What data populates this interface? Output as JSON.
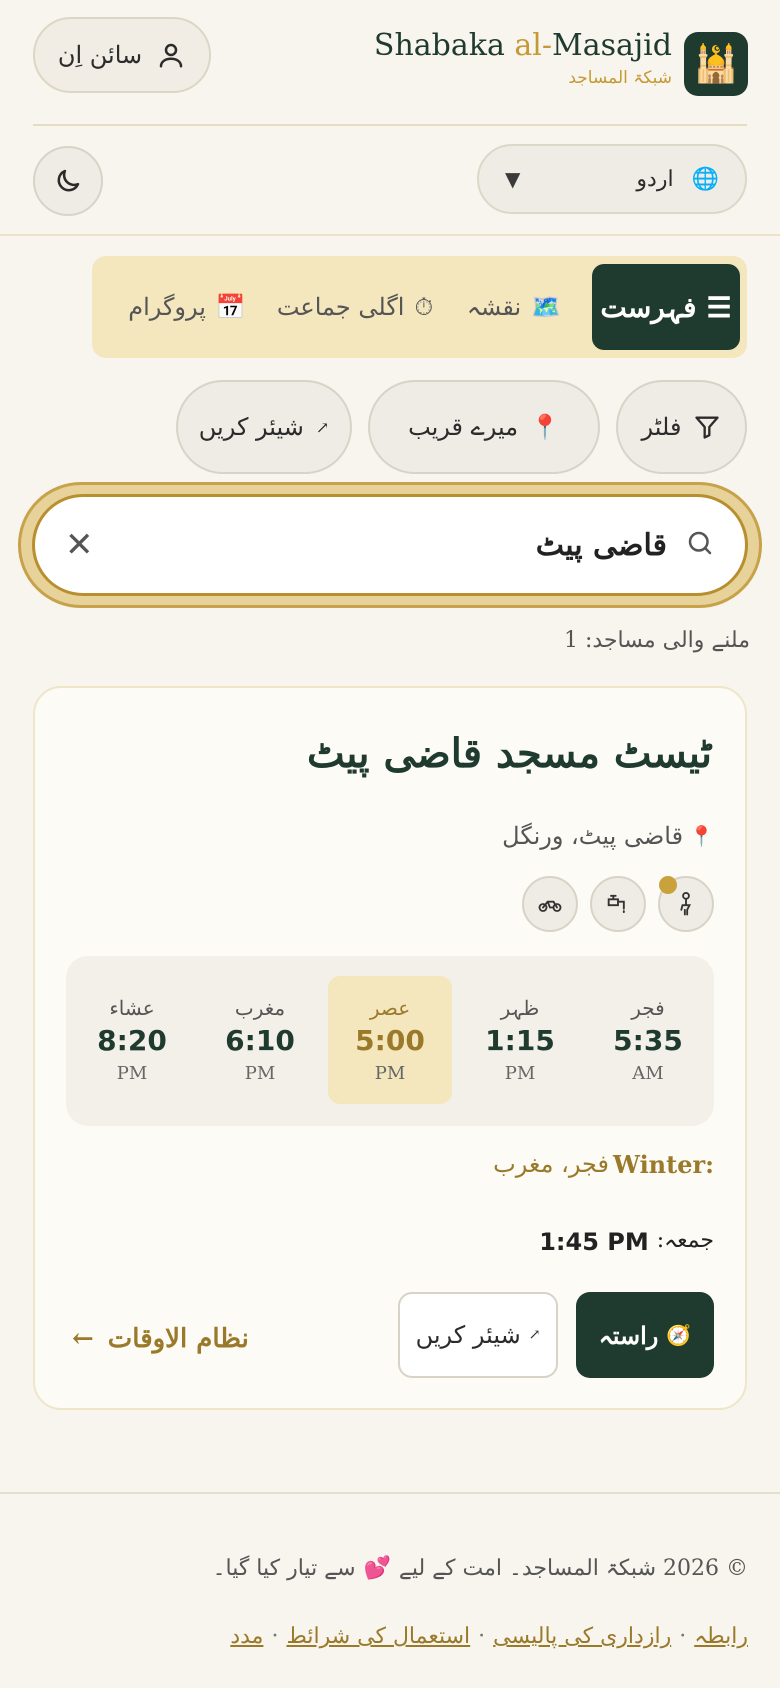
{
  "header": {
    "signin_label": "سائن اِن",
    "brand_title_pre": "Shabaka ",
    "brand_title_al": "al-",
    "brand_title_post": "Masajid",
    "brand_subtitle": "شبکۃ المساجد",
    "logo_emoji": "🕌"
  },
  "language": {
    "selected": "اردو",
    "globe": "🌐",
    "arrow": "▼"
  },
  "tabs": [
    {
      "label": "فہرست",
      "icon": "☰",
      "active": true
    },
    {
      "label": "نقشہ",
      "icon": "🗺️",
      "active": false
    },
    {
      "label": "اگلی جماعت",
      "icon": "⏱",
      "active": false
    },
    {
      "label": "پروگرام",
      "icon": "📅",
      "active": false
    }
  ],
  "actions": {
    "filter_label": "فلٹر",
    "nearby_label": "میرے قریب",
    "nearby_icon": "📍",
    "share_label": "شیئر کریں",
    "share_icon": "↗"
  },
  "search": {
    "value": "قاضی پیٹ",
    "clear": "✕"
  },
  "results": {
    "count_text": "ملنے والی مساجد: 1"
  },
  "mosque": {
    "name": "ٹیسٹ مسجد قاضی پیٹ",
    "location_icon": "📍",
    "location": "قاضی پیٹ، ورنگل",
    "prayers": [
      {
        "name": "فجر",
        "time": "5:35",
        "ampm": "AM",
        "active": false
      },
      {
        "name": "ظہر",
        "time": "1:15",
        "ampm": "PM",
        "active": false
      },
      {
        "name": "عصر",
        "time": "5:00",
        "ampm": "PM",
        "active": true
      },
      {
        "name": "مغرب",
        "time": "6:10",
        "ampm": "PM",
        "active": false
      },
      {
        "name": "عشاء",
        "time": "8:20",
        "ampm": "PM",
        "active": false
      }
    ],
    "season_label": "Winter:",
    "season_value": "فجر، مغرب",
    "juma_label": "جمعہ:",
    "juma_time": "1:45 PM",
    "route_label": "راستہ",
    "route_icon": "🧭",
    "share_label": "شیئر کریں",
    "share_icon": "↗",
    "schedule_label": "نظام الاوقات",
    "schedule_arrow": "←"
  },
  "footer": {
    "copyright": "© 2026 شبکۃ المساجد۔ امت کے لیے",
    "heart": "💕",
    "made_text": "سے تیار کیا گیا۔",
    "links": [
      "رابطہ",
      "رازداری کی پالیسی",
      "استعمال کی شرائط",
      "مدد"
    ],
    "sep": "·"
  },
  "colors": {
    "primary": "#1f3a2e",
    "accent": "#c39a35",
    "background": "#f8f5ee"
  }
}
